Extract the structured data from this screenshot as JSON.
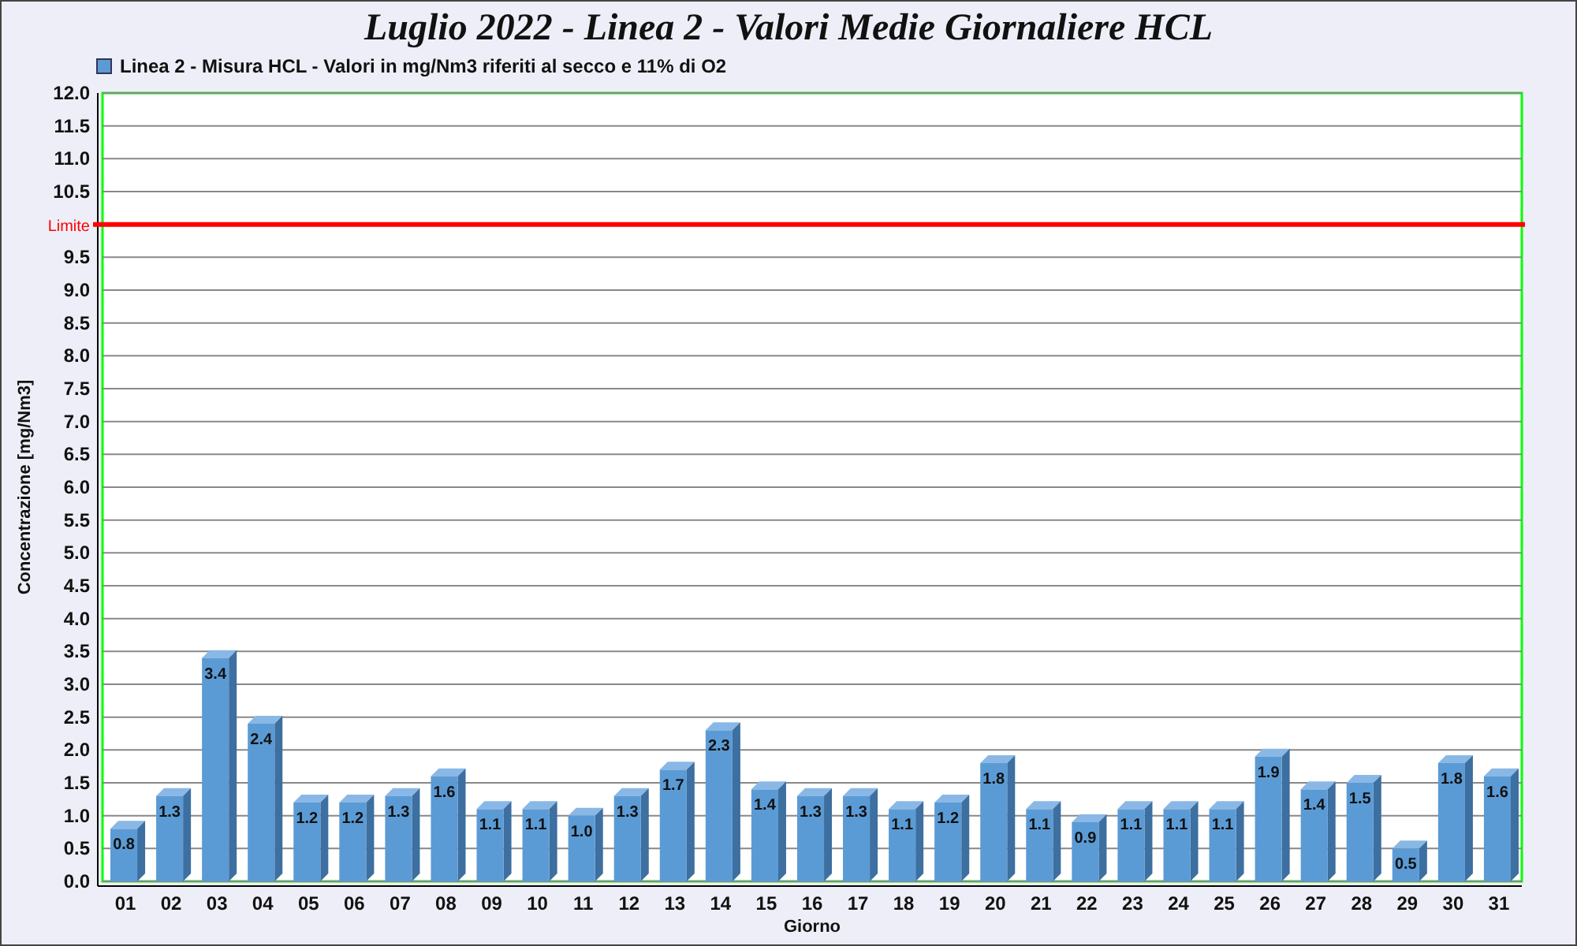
{
  "chart": {
    "title": "Luglio 2022 - Linea 2 - Valori Medie Giornaliere HCL",
    "chart_data": {
      "type": "bar",
      "xlabel": "Giorno",
      "ylabel": "Concentrazione [mg/Nm3]",
      "categories": [
        "01",
        "02",
        "03",
        "04",
        "05",
        "06",
        "07",
        "08",
        "09",
        "10",
        "11",
        "12",
        "13",
        "14",
        "15",
        "16",
        "17",
        "18",
        "19",
        "20",
        "21",
        "22",
        "23",
        "24",
        "25",
        "26",
        "27",
        "28",
        "29",
        "30",
        "31"
      ],
      "series": [
        {
          "name": "Linea 2 - Misura HCL - Valori in mg/Nm3 riferiti al secco e 11% di O2",
          "color": "#5b9bd5",
          "values": [
            0.8,
            1.3,
            3.4,
            2.4,
            1.2,
            1.2,
            1.3,
            1.6,
            1.1,
            1.1,
            1.0,
            1.3,
            1.7,
            2.3,
            1.4,
            1.3,
            1.3,
            1.1,
            1.2,
            1.8,
            1.1,
            0.9,
            1.1,
            1.1,
            1.1,
            1.9,
            1.4,
            1.5,
            0.5,
            1.8,
            1.6
          ]
        }
      ],
      "value_labels": [
        "0.8",
        "1.3",
        "3.4",
        "2.4",
        "1.2",
        "1.2",
        "1.3",
        "1.6",
        "1.1",
        "1.1",
        "1.0",
        "1.3",
        "1.7",
        "2.3",
        "1.4",
        "1.3",
        "1.3",
        "1.1",
        "1.2",
        "1.8",
        "1.1",
        "0.9",
        "1.1",
        "1.1",
        "1.1",
        "1.9",
        "1.4",
        "1.5",
        "0.5",
        "1.8",
        "1.6"
      ],
      "ylim": [
        0,
        12
      ],
      "yticks": [
        {
          "value": 0,
          "label": "0.0"
        },
        {
          "value": 0.5,
          "label": "0.5"
        },
        {
          "value": 1,
          "label": "1.0"
        },
        {
          "value": 1.5,
          "label": "1.5"
        },
        {
          "value": 2,
          "label": "2.0"
        },
        {
          "value": 2.5,
          "label": "2.5"
        },
        {
          "value": 3,
          "label": "3.0"
        },
        {
          "value": 3.5,
          "label": "3.5"
        },
        {
          "value": 4,
          "label": "4.0"
        },
        {
          "value": 4.5,
          "label": "4.5"
        },
        {
          "value": 5,
          "label": "5.0"
        },
        {
          "value": 5.5,
          "label": "5.5"
        },
        {
          "value": 6,
          "label": "6.0"
        },
        {
          "value": 6.5,
          "label": "6.5"
        },
        {
          "value": 7,
          "label": "7.0"
        },
        {
          "value": 7.5,
          "label": "7.5"
        },
        {
          "value": 8,
          "label": "8.0"
        },
        {
          "value": 8.5,
          "label": "8.5"
        },
        {
          "value": 9,
          "label": "9.0"
        },
        {
          "value": 9.5,
          "label": "9.5"
        },
        {
          "value": 10,
          "label": "Limite"
        },
        {
          "value": 10.5,
          "label": "10.5"
        },
        {
          "value": 11,
          "label": "11.0"
        },
        {
          "value": 11.5,
          "label": "11.5"
        },
        {
          "value": 12,
          "label": "12.0"
        }
      ],
      "grid": true,
      "ref_lines": [
        {
          "axis": "y",
          "value": 10,
          "color": "#ff0000"
        }
      ]
    }
  }
}
